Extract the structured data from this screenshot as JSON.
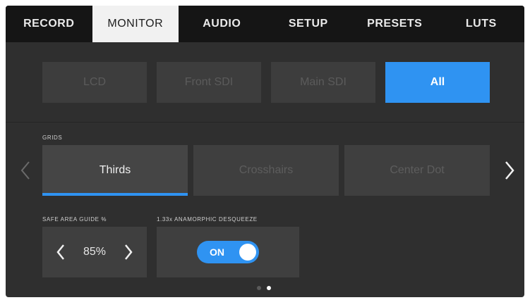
{
  "tabs": [
    {
      "label": "RECORD",
      "active": false
    },
    {
      "label": "MONITOR",
      "active": true
    },
    {
      "label": "AUDIO",
      "active": false
    },
    {
      "label": "SETUP",
      "active": false
    },
    {
      "label": "PRESETS",
      "active": false
    },
    {
      "label": "LUTS",
      "active": false
    }
  ],
  "outputs": {
    "options": [
      "LCD",
      "Front SDI",
      "Main SDI",
      "All"
    ],
    "selected": "All"
  },
  "grids": {
    "label": "GRIDS",
    "options": [
      "Thirds",
      "Crosshairs",
      "Center Dot"
    ],
    "selected": "Thirds",
    "prev_icon": "chevron-left-icon",
    "next_icon": "chevron-right-icon"
  },
  "safe_area": {
    "label": "SAFE AREA GUIDE %",
    "value": "85%",
    "decrease_icon": "chevron-left-icon",
    "increase_icon": "chevron-right-icon"
  },
  "anamorphic": {
    "label": "1.33x ANAMORPHIC DESQUEEZE",
    "toggle_label": "ON",
    "enabled": true
  },
  "pagination": {
    "pages": 2,
    "current": 2
  },
  "colors": {
    "accent": "#2f93f2",
    "tabbar": "#151515",
    "panel": "#2f2f2f",
    "active_tab": "#f1f1f1"
  }
}
